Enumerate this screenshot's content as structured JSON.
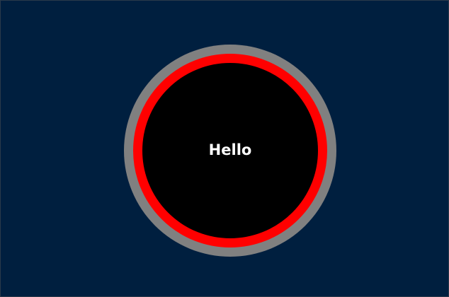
{
  "canvas": {
    "background_color": "#001f3f"
  },
  "circle_button": {
    "label": "Hello",
    "outer_ring_color": "#808080",
    "inner_ring_color": "#ff0000",
    "fill_color": "#000000",
    "text_color": "#ffffff"
  }
}
